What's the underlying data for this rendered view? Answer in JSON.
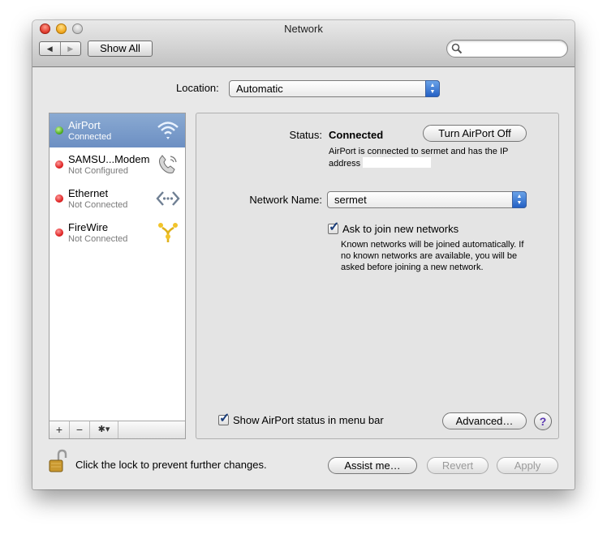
{
  "window": {
    "title": "Network"
  },
  "toolbar": {
    "back_glyph": "◀",
    "forward_glyph": "▶",
    "show_all_label": "Show All",
    "search_placeholder": ""
  },
  "location": {
    "label": "Location:",
    "value": "Automatic"
  },
  "sidebar": {
    "items": [
      {
        "name": "AirPort",
        "status": "Connected",
        "indicator": "green",
        "icon": "wifi-icon",
        "selected": true
      },
      {
        "name": "SAMSU...Modem",
        "status": "Not Configured",
        "indicator": "red",
        "icon": "phone-icon",
        "selected": false
      },
      {
        "name": "Ethernet",
        "status": "Not Connected",
        "indicator": "red",
        "icon": "ethernet-icon",
        "selected": false
      },
      {
        "name": "FireWire",
        "status": "Not Connected",
        "indicator": "red",
        "icon": "firewire-icon",
        "selected": false
      }
    ],
    "add_glyph": "+",
    "remove_glyph": "−",
    "action_glyph": "✱▾"
  },
  "detail": {
    "status_label": "Status:",
    "status_value": "Connected",
    "turn_off_label": "Turn AirPort Off",
    "status_description": "AirPort is connected to sermet and has the IP address",
    "network_name_label": "Network Name:",
    "network_name_value": "sermet",
    "ask_join_label": "Ask to join new networks",
    "ask_join_checked": true,
    "ask_join_description": "Known networks will be joined automatically. If no known networks are available, you will be asked before joining a new network.",
    "show_status_label": "Show AirPort status in menu bar",
    "show_status_checked": true,
    "advanced_label": "Advanced…",
    "help_glyph": "?"
  },
  "footer": {
    "lock_text": "Click the lock to prevent further changes.",
    "assist_label": "Assist me…",
    "revert_label": "Revert",
    "apply_label": "Apply"
  },
  "colors": {
    "selection": "#7b9ccb",
    "popup_arrow": "#3a78d6",
    "status_green": "#4aaa1c",
    "status_red": "#de1e1e"
  }
}
